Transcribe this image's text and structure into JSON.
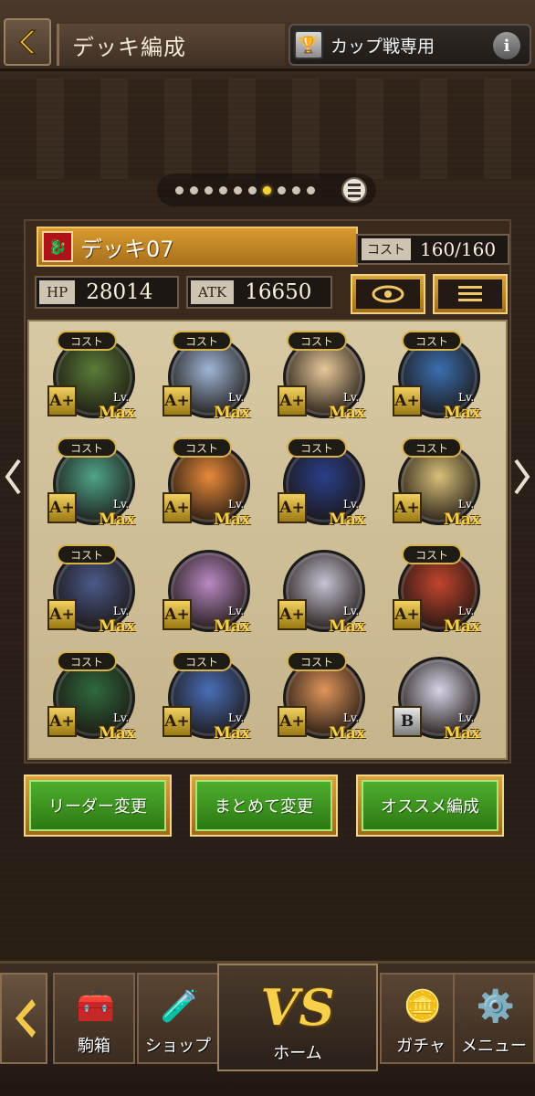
{
  "header": {
    "title": "デッキ編成",
    "cup_mode_label": "カップ戦専用",
    "info_label": "i"
  },
  "pagination": {
    "total": 10,
    "active_index": 6
  },
  "deck": {
    "name": "デッキ07",
    "cost_label": "コスト",
    "cost_value": "160/160",
    "hp_label": "HP",
    "hp_value": "28014",
    "atk_label": "ATK",
    "atk_value": "16650"
  },
  "units": [
    {
      "cost_tag": "コスト",
      "rank": "A+",
      "level_label": "Lv.",
      "level": "Max",
      "color": "#5a7d3a"
    },
    {
      "cost_tag": "コスト",
      "rank": "A+",
      "level_label": "Lv.",
      "level": "Max",
      "color": "#9fb6d6"
    },
    {
      "cost_tag": "コスト",
      "rank": "A+",
      "level_label": "Lv.",
      "level": "Max",
      "color": "#e8c99a"
    },
    {
      "cost_tag": "コスト",
      "rank": "A+",
      "level_label": "Lv.",
      "level": "Max",
      "color": "#3b6fb0"
    },
    {
      "cost_tag": "コスト",
      "rank": "A+",
      "level_label": "Lv.",
      "level": "Max",
      "color": "#4fa58a"
    },
    {
      "cost_tag": "コスト",
      "rank": "A+",
      "level_label": "Lv.",
      "level": "Max",
      "color": "#e88a3a"
    },
    {
      "cost_tag": "コスト",
      "rank": "A+",
      "level_label": "Lv.",
      "level": "Max",
      "color": "#2a3f8a"
    },
    {
      "cost_tag": "コスト",
      "rank": "A+",
      "level_label": "Lv.",
      "level": "Max",
      "color": "#d9c07a"
    },
    {
      "cost_tag": "コスト",
      "rank": "A+",
      "level_label": "Lv.",
      "level": "Max",
      "color": "#4a5a8a"
    },
    {
      "cost_tag": "",
      "rank": "A+",
      "level_label": "Lv.",
      "level": "Max",
      "color": "#b98ac4"
    },
    {
      "cost_tag": "",
      "rank": "A+",
      "level_label": "Lv.",
      "level": "Max",
      "color": "#c9c3d4"
    },
    {
      "cost_tag": "コスト",
      "rank": "A+",
      "level_label": "Lv.",
      "level": "Max",
      "color": "#c2452e"
    },
    {
      "cost_tag": "コスト",
      "rank": "A+",
      "level_label": "Lv.",
      "level": "Max",
      "color": "#2f6a3e"
    },
    {
      "cost_tag": "コスト",
      "rank": "A+",
      "level_label": "Lv.",
      "level": "Max",
      "color": "#4a6fb8"
    },
    {
      "cost_tag": "コスト",
      "rank": "A+",
      "level_label": "Lv.",
      "level": "Max",
      "color": "#e0955a"
    },
    {
      "cost_tag": "",
      "rank": "B",
      "level_label": "Lv.",
      "level": "Max",
      "color": "#d8d3e6"
    }
  ],
  "actions": {
    "leader_change": "リーダー変更",
    "bulk_change": "まとめて変更",
    "recommended": "オススメ編成"
  },
  "bottom_nav": {
    "storage": "駒箱",
    "shop": "ショップ",
    "vs": "VS",
    "home": "ホーム",
    "gacha": "ガチャ",
    "menu": "メニュー"
  },
  "colors": {
    "accent_gold": "#d8a43a",
    "button_green": "#3f9a22",
    "deck_flag": "#b0121a"
  }
}
